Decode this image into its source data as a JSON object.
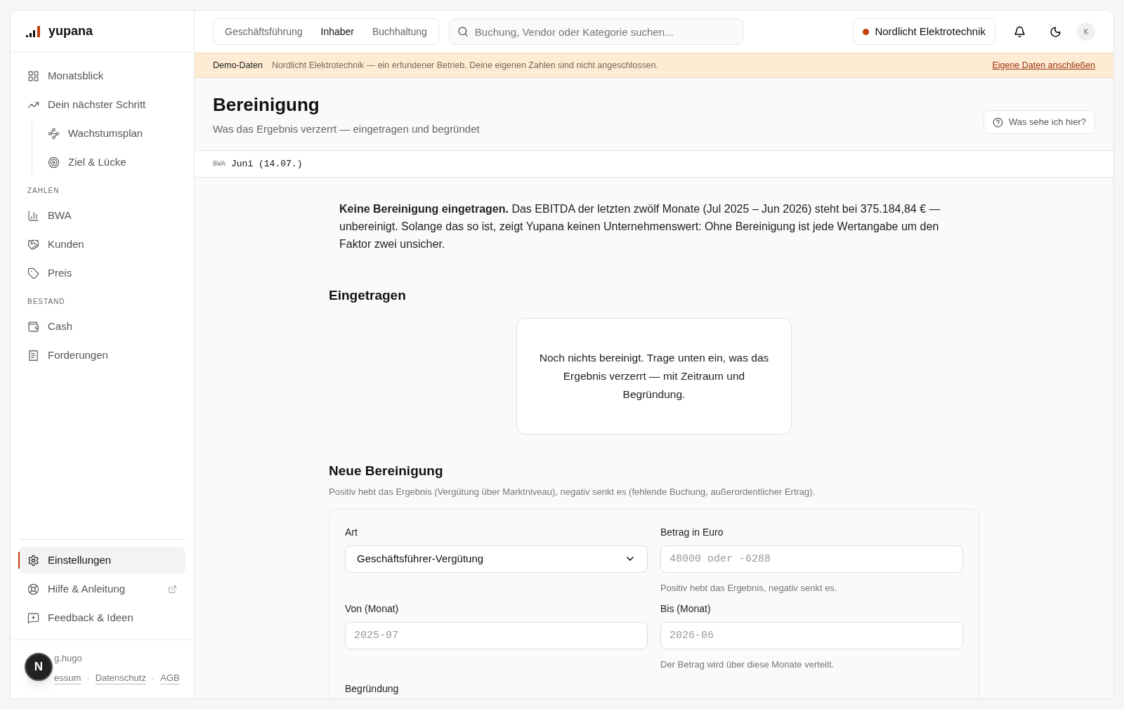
{
  "sidebar": {
    "logo": "yupana",
    "sections": [
      {
        "items": [
          {
            "label": "Monatsblick",
            "selected": false
          },
          {
            "label": "Dein nächster Schritt",
            "selected": false,
            "children": [
              {
                "label": "Wachstumsplan",
                "selected": false
              },
              {
                "label": "Ziel & Lücke",
                "selected": false
              }
            ]
          }
        ]
      },
      {
        "heading": "ZAHLEN",
        "items": [
          {
            "label": "BWA",
            "selected": false
          },
          {
            "label": "Kunden",
            "selected": false
          },
          {
            "label": "Preis",
            "selected": false
          }
        ]
      },
      {
        "heading": "BESTAND",
        "items": [
          {
            "label": "Cash",
            "selected": false
          },
          {
            "label": "Forderungen",
            "selected": false
          }
        ]
      }
    ],
    "bottom_items": [
      {
        "label": "Einstellungen",
        "selected": true,
        "external": false
      },
      {
        "label": "Hilfe & Anleitung",
        "selected": false,
        "external": true
      },
      {
        "label": "Feedback & Ideen",
        "selected": false,
        "external": false
      }
    ],
    "footer": {
      "credit": "g.hugo",
      "links": [
        "essum",
        "Datenschutz",
        "AGB"
      ],
      "separator": "·",
      "badge": "N"
    }
  },
  "header": {
    "tabs": [
      {
        "label": "Geschäftsführung",
        "selected": false
      },
      {
        "label": "Inhaber",
        "selected": true
      },
      {
        "label": "Buchhaltung",
        "selected": false
      }
    ],
    "search": {
      "placeholder": "Buchung, Vendor oder Kategorie suchen..."
    },
    "company": "Nordlicht Elektrotechnik",
    "avatar": "K"
  },
  "banner": {
    "label": "Demo-Daten",
    "text": "Nordlicht Elektrotechnik — ein erfundener Betrieb. Deine eigenen Zahlen sind nicht angeschlossen.",
    "link": "Eigene Daten anschließen"
  },
  "page": {
    "title": "Bereinigung",
    "subtitle": "Was das Ergebnis verzerrt — eingetragen und begründet",
    "help_button": "Was sehe ich hier?",
    "source": {
      "label": "BWA",
      "value": "Juni (14.07.)"
    }
  },
  "notice": "**Keine Bereinigung eingetragen.** Das EBITDA der letzten zwölf Monate (Jul 2025 – Jun 2026) steht bei 375.184,84 € — unbereinigt. Solange das so ist, zeigt Yupana keinen Unternehmenswert: Ohne Bereinigung ist jede Wertangabe um den Faktor zwei unsicher.",
  "entered": {
    "heading": "Eingetragen",
    "empty_text": "Noch nichts bereinigt. Trage unten ein, was das Ergebnis verzerrt — mit Zeitraum und Begründung."
  },
  "new_adjustment": {
    "heading": "Neue Bereinigung",
    "description": "Positiv hebt das Ergebnis (Vergütung über Marktniveau), negativ senkt es (fehlende Buchung, außerordentlicher Ertrag).",
    "fields": [
      {
        "kind": "select",
        "label": "Art",
        "value": "Geschäftsführer-Vergütung"
      },
      {
        "kind": "input",
        "label": "Betrag in Euro",
        "placeholder": "48000 oder -6288",
        "hint": "Positiv hebt das Ergebnis, negativ senkt es."
      },
      {
        "kind": "input",
        "label": "Von (Monat)",
        "placeholder": "2025-07"
      },
      {
        "kind": "input",
        "label": "Bis (Monat)",
        "placeholder": "2026-06",
        "hint": "Der Betrag wird über diese Monate verteilt."
      },
      {
        "kind": "label",
        "label": "Begründung"
      }
    ]
  }
}
